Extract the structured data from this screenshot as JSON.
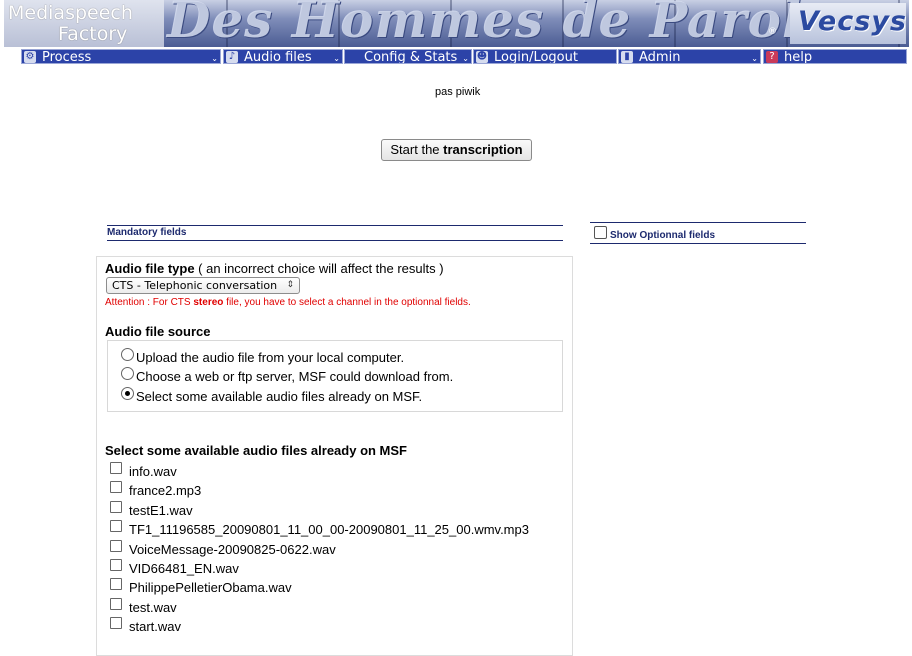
{
  "banner": {
    "app_line1": "Mediaspeech",
    "app_line2": "Factory",
    "title": "Des Hommes de Parole",
    "registered": "®",
    "company": "Vecsys"
  },
  "menu": [
    {
      "label": "Process",
      "icon": "gear-icon",
      "dropdown": true
    },
    {
      "label": "Audio files",
      "icon": "music-note-icon",
      "dropdown": true
    },
    {
      "label": "Config & Stats",
      "icon": "",
      "dropdown": true
    },
    {
      "label": "Login/Logout",
      "icon": "users-icon",
      "dropdown": false
    },
    {
      "label": "Admin",
      "icon": "admin-icon",
      "dropdown": true
    },
    {
      "label": "help",
      "icon": "help-icon",
      "dropdown": false
    }
  ],
  "piwik_text": "pas piwik",
  "start_button": {
    "prefix": "Start the ",
    "bold": "transcription"
  },
  "mandatory_header": "Mandatory fields",
  "optional_header": "Show Optionnal fields",
  "audio_type": {
    "label": "Audio file type",
    "note": " ( an incorrect choice will affect the results )",
    "selected": "CTS - Telephonic conversation",
    "attention_prefix": "Attention : For CTS ",
    "attention_bold": "stereo",
    "attention_suffix": " file, you have to select a channel in the optionnal fields."
  },
  "audio_source": {
    "label": "Audio file source",
    "options": [
      {
        "label": "Upload the audio file from your local computer.",
        "selected": false
      },
      {
        "label": "Choose a web or ftp server, MSF could download from.",
        "selected": false
      },
      {
        "label": "Select some available audio files already on MSF.",
        "selected": true
      }
    ]
  },
  "files_section": {
    "label": "Select some available audio files already on MSF",
    "files": [
      "info.wav",
      "france2.mp3",
      "testE1.wav",
      "TF1_11196585_20090801_11_00_00-20090801_11_25_00.wmv.mp3",
      "VoiceMessage-20090825-0622.wav",
      "VID66481_EN.wav",
      "PhilippePelletierObama.wav",
      "test.wav",
      "start.wav"
    ]
  },
  "colors": {
    "menu_bg": "#2c43a8",
    "attention": "#e00000",
    "header_text": "#1d2a6e"
  }
}
